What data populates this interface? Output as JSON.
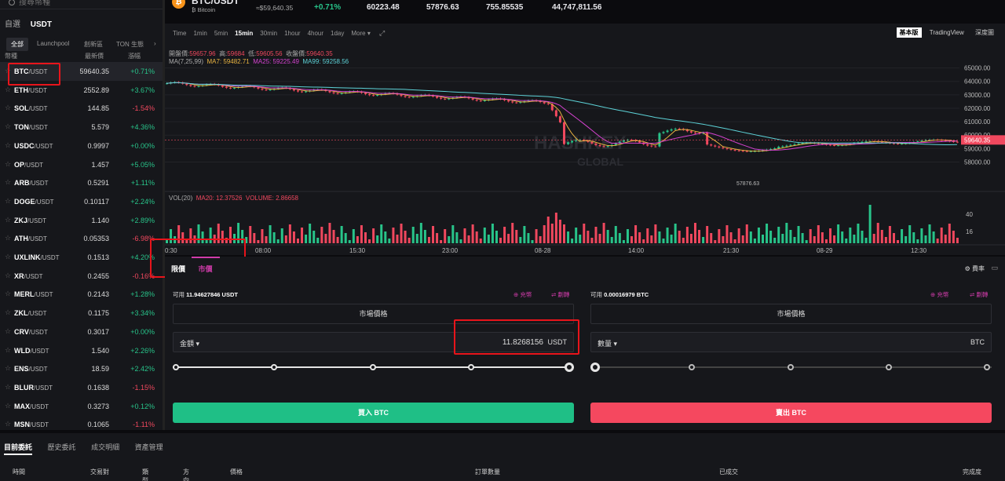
{
  "search": {
    "placeholder": "搜尋幣種"
  },
  "sidebar": {
    "main_tabs": [
      "自選",
      "USDT"
    ],
    "sub_tabs": [
      "全部",
      "Launchpool",
      "創新區",
      "TON 生態"
    ],
    "sub_tab_more": "›",
    "columns": {
      "pair": "幣種",
      "price": "最新價",
      "change": "漲幅"
    },
    "rows": [
      {
        "base": "BTC",
        "quote": "/USDT",
        "price": "59640.35",
        "change": "+0.71%",
        "dir": "up"
      },
      {
        "base": "ETH",
        "quote": "/USDT",
        "price": "2552.89",
        "change": "+3.67%",
        "dir": "up"
      },
      {
        "base": "SOL",
        "quote": "/USDT",
        "price": "144.85",
        "change": "-1.54%",
        "dir": "dn"
      },
      {
        "base": "TON",
        "quote": "/USDT",
        "price": "5.579",
        "change": "+4.36%",
        "dir": "up"
      },
      {
        "base": "USDC",
        "quote": "/USDT",
        "price": "0.9997",
        "change": "+0.00%",
        "dir": "up"
      },
      {
        "base": "OP",
        "quote": "/USDT",
        "price": "1.457",
        "change": "+5.05%",
        "dir": "up"
      },
      {
        "base": "ARB",
        "quote": "/USDT",
        "price": "0.5291",
        "change": "+1.11%",
        "dir": "up"
      },
      {
        "base": "DOGE",
        "quote": "/USDT",
        "price": "0.10117",
        "change": "+2.24%",
        "dir": "up"
      },
      {
        "base": "ZKJ",
        "quote": "/USDT",
        "price": "1.140",
        "change": "+2.89%",
        "dir": "up"
      },
      {
        "base": "ATH",
        "quote": "/USDT",
        "price": "0.05353",
        "change": "-6.98%",
        "dir": "dn"
      },
      {
        "base": "UXLINK",
        "quote": "/USDT",
        "price": "0.1513",
        "change": "+4.20%",
        "dir": "up"
      },
      {
        "base": "XR",
        "quote": "/USDT",
        "price": "0.2455",
        "change": "-0.16%",
        "dir": "dn"
      },
      {
        "base": "MERL",
        "quote": "/USDT",
        "price": "0.2143",
        "change": "+1.28%",
        "dir": "up"
      },
      {
        "base": "ZKL",
        "quote": "/USDT",
        "price": "0.1175",
        "change": "+3.34%",
        "dir": "up"
      },
      {
        "base": "CRV",
        "quote": "/USDT",
        "price": "0.3017",
        "change": "+0.00%",
        "dir": "up"
      },
      {
        "base": "WLD",
        "quote": "/USDT",
        "price": "1.540",
        "change": "+2.26%",
        "dir": "up"
      },
      {
        "base": "ENS",
        "quote": "/USDT",
        "price": "18.59",
        "change": "+2.42%",
        "dir": "up"
      },
      {
        "base": "BLUR",
        "quote": "/USDT",
        "price": "0.1638",
        "change": "-1.15%",
        "dir": "dn"
      },
      {
        "base": "MAX",
        "quote": "/USDT",
        "price": "0.3273",
        "change": "+0.12%",
        "dir": "up"
      },
      {
        "base": "MSN",
        "quote": "/USDT",
        "price": "0.1065",
        "change": "-1.11%",
        "dir": "dn"
      }
    ]
  },
  "header": {
    "symbol": "BTC/USDT",
    "name": "Bitcoin",
    "name_prefix": "₿",
    "approx_price": "≈$59,640.35",
    "change": "+0.71%",
    "high": "60223.48",
    "low": "57876.63",
    "vol_base": "755.85535",
    "vol_quote": "44,747,811.56"
  },
  "chart": {
    "intervals": [
      "Time",
      "1min",
      "5min",
      "15min",
      "30min",
      "1hour",
      "4hour",
      "1day",
      "More ▾"
    ],
    "active_interval": "15min",
    "views": [
      "基本版",
      "TradingView",
      "深度圖"
    ],
    "ohlc": {
      "open_label": "開盤價:",
      "open": "59657.96",
      "high_label": "高:",
      "high": "59684",
      "low_label": "低:",
      "low": "59605.56",
      "close_label": "收盤價:",
      "close": "59640.35"
    },
    "ma": {
      "label": "MA(7,25,99)",
      "ma7": "MA7: 59482.71",
      "ma25": "MA25: 59225.49",
      "ma99": "MA99: 59258.56"
    },
    "price_ticks": [
      "65000.00",
      "64000.00",
      "63000.00",
      "62000.00",
      "61000.00",
      "60000.00",
      "59000.00",
      "58000.00"
    ],
    "current_price": "59640.35",
    "low_marker": "57876.63",
    "watermark1": "HASHKEY",
    "watermark2": "GLOBAL",
    "vol": {
      "label": "VOL(20)",
      "ma20": "MA20: 12.37526",
      "volume": "VOLUME: 2.86658"
    },
    "vol_ticks": [
      "40",
      "16"
    ],
    "time_ticks": [
      "0:30",
      "08:00",
      "15:30",
      "23:00",
      "08-28",
      "14:00",
      "21:30",
      "08-29",
      "12:30"
    ]
  },
  "order": {
    "tabs": [
      "限價",
      "市價"
    ],
    "fee_label": "費率",
    "buy": {
      "avail_label": "可用",
      "avail": "11.94627846 USDT",
      "deposit": "充幣",
      "transfer": "劃轉",
      "market_price": "市場價格",
      "amount_label": "金額",
      "amount": "11.8268156",
      "unit": "USDT",
      "button": "買入 BTC"
    },
    "sell": {
      "avail_label": "可用",
      "avail": "0.00016979 BTC",
      "deposit": "充幣",
      "transfer": "劃轉",
      "market_price": "市場價格",
      "amount_label": "數量",
      "unit": "BTC",
      "button": "賣出 BTC"
    }
  },
  "bottom": {
    "tabs": [
      "目前委託",
      "歷史委託",
      "成交明細",
      "資產管理"
    ],
    "columns": [
      "時間",
      "交易對",
      "類型",
      "方向",
      "價格",
      "訂單數量",
      "已成交",
      "完成度"
    ]
  },
  "colors": {
    "up": "#28c48a",
    "down": "#f0485e",
    "accent": "#d03caa",
    "buy": "#1fbf86",
    "sell": "#f5485f"
  }
}
